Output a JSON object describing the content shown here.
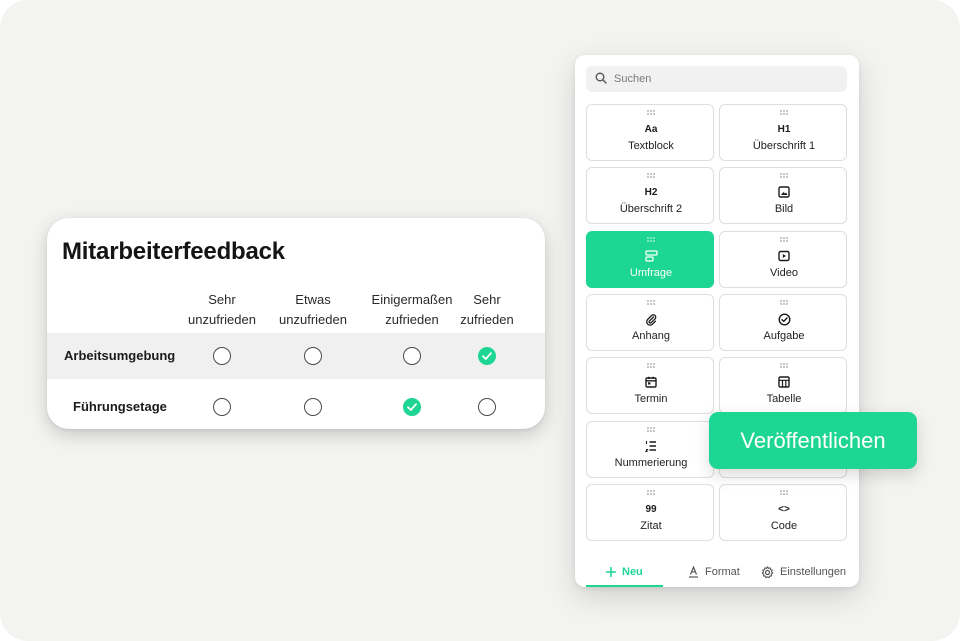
{
  "survey": {
    "title": "Mitarbeiterfeedback",
    "columns": [
      {
        "line1": "Sehr",
        "line2": "unzufrieden"
      },
      {
        "line1": "Etwas",
        "line2": "unzufrieden"
      },
      {
        "line1": "Einigermaßen",
        "line2": "zufrieden"
      },
      {
        "line1": "Sehr",
        "line2": "zufrieden"
      }
    ],
    "rows": [
      {
        "label": "Arbeitsumgebung",
        "selected_column": 4
      },
      {
        "label": "Führungsetage",
        "selected_column": 3
      }
    ]
  },
  "panel": {
    "search": {
      "placeholder": "Suchen",
      "value": ""
    },
    "blocks": [
      {
        "label": "Textblock",
        "icon": "text-aa-icon",
        "glyph": "Aa"
      },
      {
        "label": "Überschrift 1",
        "icon": "heading-1-icon",
        "glyph": "H1"
      },
      {
        "label": "Überschrift 2",
        "icon": "heading-2-icon",
        "glyph": "H2"
      },
      {
        "label": "Bild",
        "icon": "image-icon"
      },
      {
        "label": "Umfrage",
        "icon": "poll-icon",
        "active": true
      },
      {
        "label": "Video",
        "icon": "video-icon"
      },
      {
        "label": "Anhang",
        "icon": "paperclip-icon"
      },
      {
        "label": "Aufgabe",
        "icon": "check-circle-icon"
      },
      {
        "label": "Termin",
        "icon": "calendar-icon"
      },
      {
        "label": "Tabelle",
        "icon": "table-icon"
      },
      {
        "label": "Nummerierung",
        "icon": "numbered-list-icon"
      },
      {
        "label": "",
        "icon": ""
      },
      {
        "label": "Zitat",
        "icon": "quote-icon",
        "glyph": "99"
      },
      {
        "label": "Code",
        "icon": "code-icon",
        "glyph": "<>"
      }
    ],
    "tabs": [
      {
        "label": "Neu",
        "icon": "plus-icon",
        "active": true
      },
      {
        "label": "Format",
        "icon": "text-format-icon"
      },
      {
        "label": "Einstellungen",
        "icon": "gear-icon"
      }
    ]
  },
  "publish_button": {
    "label": "Veröffentlichen"
  },
  "colors": {
    "accent": "#1ed694",
    "background": "#f3f3f1"
  }
}
